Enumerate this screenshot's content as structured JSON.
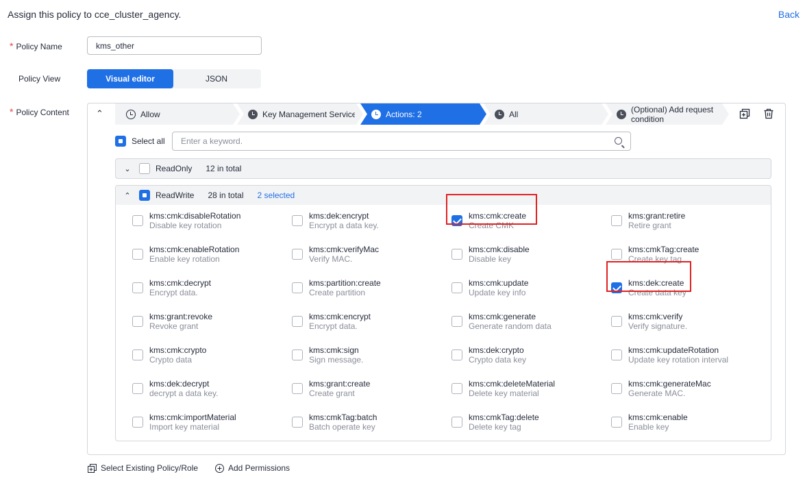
{
  "header": {
    "title": "Assign this policy to cce_cluster_agency.",
    "back_label": "Back"
  },
  "form": {
    "policy_name_label": "Policy Name",
    "policy_name_value": "kms_other",
    "policy_view_label": "Policy View",
    "view_options": [
      "Visual editor",
      "JSON"
    ],
    "policy_content_label": "Policy Content"
  },
  "steps": [
    {
      "label": "Allow"
    },
    {
      "label": "Key Management Service"
    },
    {
      "label": "Actions: 2"
    },
    {
      "label": "All"
    },
    {
      "label": "(Optional) Add request condition"
    }
  ],
  "search": {
    "select_all_label": "Select all",
    "placeholder": "Enter a keyword."
  },
  "groups": {
    "readonly": {
      "name": "ReadOnly",
      "count": "12 in total"
    },
    "readwrite": {
      "name": "ReadWrite",
      "count": "28 in total",
      "selected": "2 selected"
    }
  },
  "actions": [
    [
      {
        "name": "kms:cmk:disableRotation",
        "desc": "Disable key rotation",
        "checked": false
      },
      {
        "name": "kms:dek:encrypt",
        "desc": "Encrypt a data key.",
        "checked": false
      },
      {
        "name": "kms:cmk:create",
        "desc": "Create CMK",
        "checked": true
      },
      {
        "name": "kms:grant:retire",
        "desc": "Retire grant",
        "checked": false
      }
    ],
    [
      {
        "name": "kms:cmk:enableRotation",
        "desc": "Enable key rotation",
        "checked": false
      },
      {
        "name": "kms:cmk:verifyMac",
        "desc": "Verify MAC.",
        "checked": false
      },
      {
        "name": "kms:cmk:disable",
        "desc": "Disable key",
        "checked": false
      },
      {
        "name": "kms:cmkTag:create",
        "desc": "Create key tag",
        "checked": false
      }
    ],
    [
      {
        "name": "kms:cmk:decrypt",
        "desc": "Encrypt data.",
        "checked": false
      },
      {
        "name": "kms:partition:create",
        "desc": "Create partition",
        "checked": false
      },
      {
        "name": "kms:cmk:update",
        "desc": "Update key info",
        "checked": false
      },
      {
        "name": "kms:dek:create",
        "desc": "Create data key",
        "checked": true
      }
    ],
    [
      {
        "name": "kms:grant:revoke",
        "desc": "Revoke grant",
        "checked": false
      },
      {
        "name": "kms:cmk:encrypt",
        "desc": "Encrypt data.",
        "checked": false
      },
      {
        "name": "kms:cmk:generate",
        "desc": "Generate random data",
        "checked": false
      },
      {
        "name": "kms:cmk:verify",
        "desc": "Verify signature.",
        "checked": false
      }
    ],
    [
      {
        "name": "kms:cmk:crypto",
        "desc": "Crypto data",
        "checked": false
      },
      {
        "name": "kms:cmk:sign",
        "desc": "Sign message.",
        "checked": false
      },
      {
        "name": "kms:dek:crypto",
        "desc": "Crypto data key",
        "checked": false
      },
      {
        "name": "kms:cmk:updateRotation",
        "desc": "Update key rotation interval",
        "checked": false
      }
    ],
    [
      {
        "name": "kms:dek:decrypt",
        "desc": "decrypt a data key.",
        "checked": false
      },
      {
        "name": "kms:grant:create",
        "desc": "Create grant",
        "checked": false
      },
      {
        "name": "kms:cmk:deleteMaterial",
        "desc": "Delete key material",
        "checked": false
      },
      {
        "name": "kms:cmk:generateMac",
        "desc": "Generate MAC.",
        "checked": false
      }
    ],
    [
      {
        "name": "kms:cmk:importMaterial",
        "desc": "Import key material",
        "checked": false
      },
      {
        "name": "kms:cmkTag:batch",
        "desc": "Batch operate key",
        "checked": false
      },
      {
        "name": "kms:cmkTag:delete",
        "desc": "Delete key tag",
        "checked": false
      },
      {
        "name": "kms:cmk:enable",
        "desc": "Enable key",
        "checked": false
      }
    ]
  ],
  "footer": {
    "select_existing_label": "Select Existing Policy/Role",
    "add_permissions_label": "Add Permissions"
  },
  "colors": {
    "accent": "#1f6fe5",
    "highlight": "#e02020"
  }
}
